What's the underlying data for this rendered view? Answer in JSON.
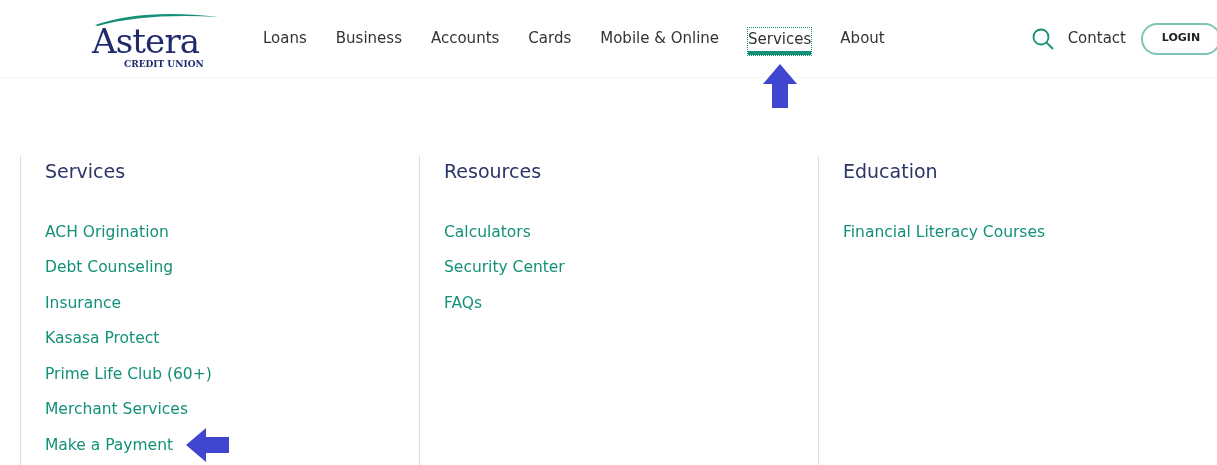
{
  "logo": {
    "name": "Astera",
    "subtitle": "CREDIT UNION"
  },
  "nav": [
    {
      "label": "Loans",
      "selected": false,
      "pointed": false
    },
    {
      "label": "Business",
      "selected": false,
      "pointed": false
    },
    {
      "label": "Accounts",
      "selected": false,
      "pointed": false
    },
    {
      "label": "Cards",
      "selected": false,
      "pointed": false
    },
    {
      "label": "Mobile & Online",
      "selected": false,
      "pointed": false
    },
    {
      "label": "Services",
      "selected": true,
      "pointed": true
    },
    {
      "label": "About",
      "selected": false,
      "pointed": false
    }
  ],
  "contact": "Contact",
  "login": "LOGIN",
  "columns": [
    {
      "title": "Services",
      "links": [
        {
          "label": "ACH Origination",
          "pointed": false
        },
        {
          "label": "Debt Counseling",
          "pointed": false
        },
        {
          "label": "Insurance",
          "pointed": false
        },
        {
          "label": "Kasasa Protect",
          "pointed": false
        },
        {
          "label": "Prime Life Club (60+)",
          "pointed": false
        },
        {
          "label": "Merchant Services",
          "pointed": false
        },
        {
          "label": "Make a Payment",
          "pointed": true
        }
      ]
    },
    {
      "title": "Resources",
      "links": [
        {
          "label": "Calculators",
          "pointed": false
        },
        {
          "label": "Security Center",
          "pointed": false
        },
        {
          "label": "FAQs",
          "pointed": false
        }
      ]
    },
    {
      "title": "Education",
      "links": [
        {
          "label": "Financial Literacy Courses",
          "pointed": false
        }
      ]
    }
  ]
}
